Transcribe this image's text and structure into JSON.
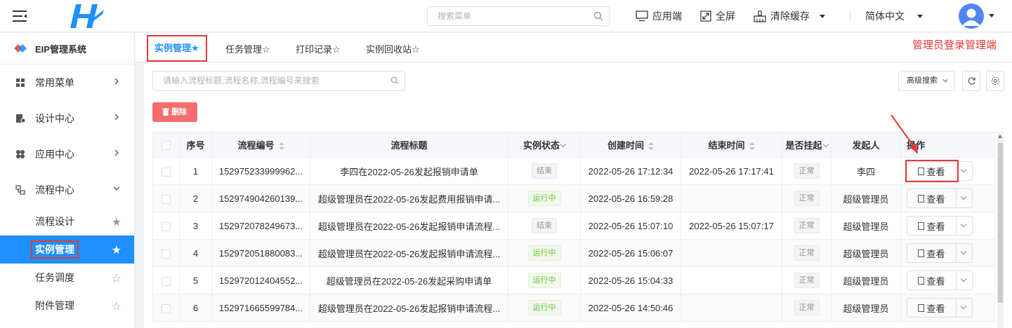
{
  "topbar": {
    "search_placeholder": "搜索菜单",
    "app_end": "应用端",
    "fullscreen": "全屏",
    "clear_cache": "清除缓存",
    "language": "简体中文"
  },
  "sidebar": {
    "system_title": "EIP管理系统",
    "items": [
      {
        "label": "常用菜单",
        "icon": "grid-icon"
      },
      {
        "label": "设计中心",
        "icon": "design-icon"
      },
      {
        "label": "应用中心",
        "icon": "app-icon"
      },
      {
        "label": "流程中心",
        "icon": "flow-icon"
      }
    ],
    "subitems": [
      {
        "label": "流程设计",
        "starred": true
      },
      {
        "label": "实例管理",
        "starred": true,
        "active": true
      },
      {
        "label": "任务调度",
        "starred": false
      },
      {
        "label": "附件管理",
        "starred": false
      }
    ]
  },
  "tabs": [
    {
      "label": "实例管理★"
    },
    {
      "label": "任务管理☆"
    },
    {
      "label": "打印记录☆"
    },
    {
      "label": "实例回收站☆"
    }
  ],
  "admin_note": "管理员登录管理端",
  "toolbar": {
    "search_placeholder": "请输入流程标题,流程名称,流程编号来搜索",
    "advanced_search": "高级搜索",
    "delete_label": "删除"
  },
  "table": {
    "headers": [
      "序号",
      "流程编号",
      "流程标题",
      "实例状态",
      "创建时间",
      "结束时间",
      "是否挂起",
      "发起人",
      "操作"
    ],
    "view_label": "查看",
    "rows": [
      {
        "no": "1",
        "code": "152975233999962...",
        "title": "李四在2022-05-26发起报销申请单",
        "status": "结束",
        "status_type": "end",
        "created": "2022-05-26 17:12:34",
        "ended": "2022-05-26 17:17:41",
        "suspended": "正常",
        "initiator": "李四"
      },
      {
        "no": "2",
        "code": "152974904260139...",
        "title": "超级管理员在2022-05-26发起费用报销申请...",
        "status": "运行中",
        "status_type": "run",
        "created": "2022-05-26 16:59:28",
        "ended": "",
        "suspended": "正常",
        "initiator": "超级管理员"
      },
      {
        "no": "3",
        "code": "152972078249673...",
        "title": "超级管理员在2022-05-26发起报销申请流程...",
        "status": "结束",
        "status_type": "end",
        "created": "2022-05-26 15:07:10",
        "ended": "2022-05-26 15:07:17",
        "suspended": "正常",
        "initiator": "超级管理员"
      },
      {
        "no": "4",
        "code": "152972051880083...",
        "title": "超级管理员在2022-05-26发起报销申请流程...",
        "status": "运行中",
        "status_type": "run",
        "created": "2022-05-26 15:06:07",
        "ended": "",
        "suspended": "正常",
        "initiator": "超级管理员"
      },
      {
        "no": "5",
        "code": "152972012404552...",
        "title": "超级管理员在2022-05-26发起采购申请单",
        "status": "运行中",
        "status_type": "run",
        "created": "2022-05-26 15:04:33",
        "ended": "",
        "suspended": "正常",
        "initiator": "超级管理员"
      },
      {
        "no": "6",
        "code": "152971665599784...",
        "title": "超级管理员在2022-05-26发起报销申请流程...",
        "status": "运行中",
        "status_type": "run",
        "created": "2022-05-26 14:50:46",
        "ended": "",
        "suspended": "正常",
        "initiator": "超级管理员"
      }
    ]
  },
  "colors": {
    "accent": "#1e90ff",
    "highlight": "#e53935",
    "danger": "#f56c6c",
    "running": "#67c23a"
  }
}
